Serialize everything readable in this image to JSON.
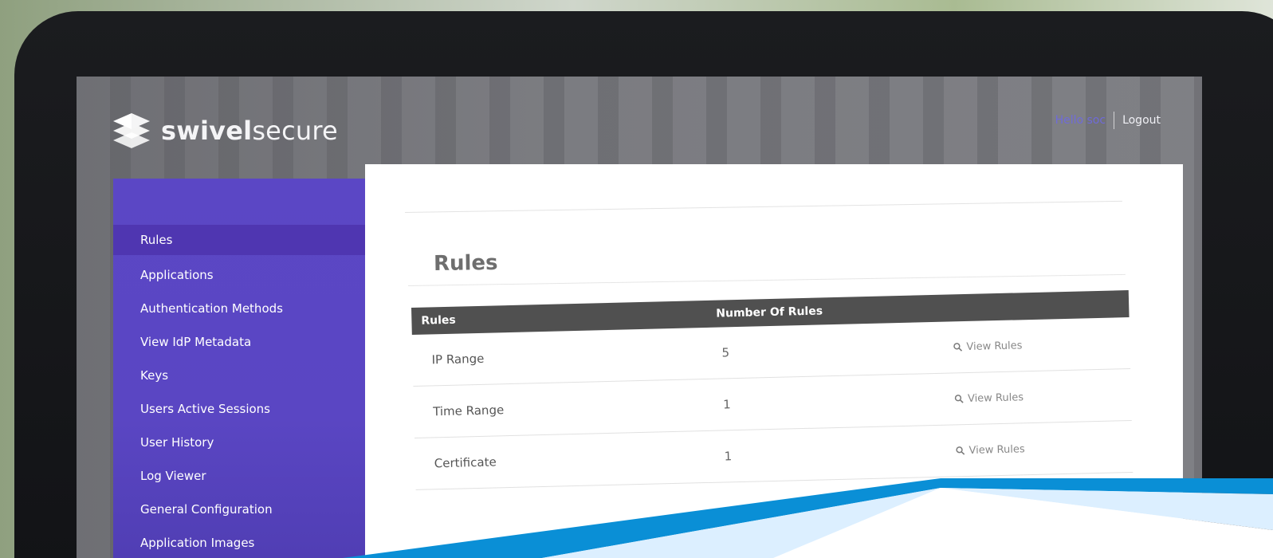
{
  "brand": {
    "name_bold": "swivel",
    "name_light": "secure",
    "logo_icon": "swivel-logo-icon"
  },
  "header": {
    "greeting": "Hello soc",
    "logout_label": "Logout"
  },
  "sidebar": {
    "items": [
      {
        "label": "Rules"
      },
      {
        "label": "Applications"
      },
      {
        "label": "Authentication Methods"
      },
      {
        "label": "View IdP Metadata"
      },
      {
        "label": "Keys"
      },
      {
        "label": "Users Active Sessions"
      },
      {
        "label": "User History"
      },
      {
        "label": "Log Viewer"
      },
      {
        "label": "General Configuration"
      },
      {
        "label": "Application Images"
      }
    ],
    "active_index": 0
  },
  "main": {
    "title": "Rules",
    "table": {
      "headers": [
        "Rules",
        "Number Of Rules",
        ""
      ],
      "rows": [
        {
          "name": "IP Range",
          "count": "5",
          "action": "View Rules"
        },
        {
          "name": "Time Range",
          "count": "1",
          "action": "View Rules"
        },
        {
          "name": "Certificate",
          "count": "1",
          "action": "View Rules"
        }
      ]
    }
  },
  "colors": {
    "sidebar": "#5a46c3",
    "sidebar_active": "#4f36b1",
    "table_header": "#505050",
    "hello_text": "#6f6bd8",
    "accent_blue": "#0a8fd6"
  }
}
